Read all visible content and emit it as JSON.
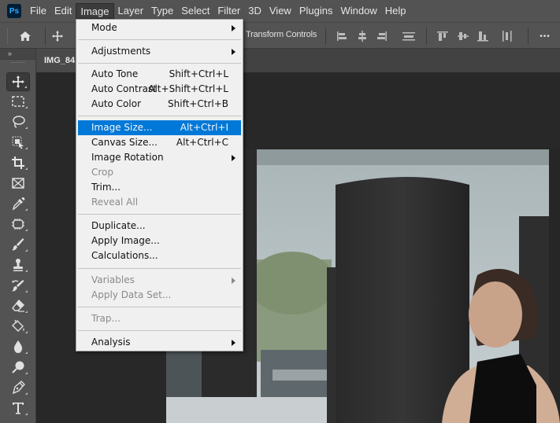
{
  "app": {
    "logo_text": "Ps",
    "name": "Adobe Photoshop"
  },
  "menubar": {
    "items": [
      {
        "label": "File"
      },
      {
        "label": "Edit"
      },
      {
        "label": "Image",
        "active": true
      },
      {
        "label": "Layer"
      },
      {
        "label": "Type"
      },
      {
        "label": "Select"
      },
      {
        "label": "Filter"
      },
      {
        "label": "3D"
      },
      {
        "label": "View"
      },
      {
        "label": "Plugins"
      },
      {
        "label": "Window"
      },
      {
        "label": "Help"
      }
    ]
  },
  "options_bar": {
    "home_icon": "home-icon",
    "move_icon": "move-icon",
    "transform_label": "Transform Controls",
    "align_icons": [
      "align-left-edges",
      "align-horizontal-centers",
      "align-right-edges",
      "distribute-vertical",
      "align-top-edges",
      "align-vertical-centers",
      "align-bottom-edges",
      "distribute-horizontal"
    ],
    "more_label": "•••"
  },
  "toolbar": {
    "collapse_label": "»",
    "tools": [
      {
        "name": "move-tool",
        "icon": "move-icon",
        "active": true
      },
      {
        "name": "rectangular-marquee-tool",
        "icon": "marquee-icon"
      },
      {
        "name": "lasso-tool",
        "icon": "lasso-icon"
      },
      {
        "name": "object-selection-tool",
        "icon": "object-selection-icon"
      },
      {
        "name": "crop-tool",
        "icon": "crop-icon"
      },
      {
        "name": "frame-tool",
        "icon": "frame-icon"
      },
      {
        "name": "eyedropper-tool",
        "icon": "eyedropper-icon"
      },
      {
        "name": "spot-healing-tool",
        "icon": "healing-icon"
      },
      {
        "name": "brush-tool",
        "icon": "brush-icon"
      },
      {
        "name": "clone-stamp-tool",
        "icon": "stamp-icon"
      },
      {
        "name": "history-brush-tool",
        "icon": "history-brush-icon"
      },
      {
        "name": "eraser-tool",
        "icon": "eraser-icon"
      },
      {
        "name": "paint-bucket-tool",
        "icon": "paint-bucket-icon"
      },
      {
        "name": "blur-tool",
        "icon": "blur-drop-icon"
      },
      {
        "name": "dodge-tool",
        "icon": "dodge-icon"
      },
      {
        "name": "pen-tool",
        "icon": "pen-icon"
      },
      {
        "name": "type-tool",
        "icon": "type-icon"
      }
    ]
  },
  "document": {
    "tab_label": "IMG_84"
  },
  "image_menu": {
    "groups": [
      [
        {
          "label": "Mode",
          "submenu": true
        }
      ],
      [
        {
          "label": "Adjustments",
          "submenu": true
        }
      ],
      [
        {
          "label": "Auto Tone",
          "shortcut": "Shift+Ctrl+L"
        },
        {
          "label": "Auto Contrast",
          "shortcut": "Alt+Shift+Ctrl+L"
        },
        {
          "label": "Auto Color",
          "shortcut": "Shift+Ctrl+B"
        }
      ],
      [
        {
          "label": "Image Size...",
          "shortcut": "Alt+Ctrl+I",
          "highlighted": true
        },
        {
          "label": "Canvas Size...",
          "shortcut": "Alt+Ctrl+C"
        },
        {
          "label": "Image Rotation",
          "submenu": true
        },
        {
          "label": "Crop",
          "disabled": true
        },
        {
          "label": "Trim..."
        },
        {
          "label": "Reveal All",
          "disabled": true
        }
      ],
      [
        {
          "label": "Duplicate..."
        },
        {
          "label": "Apply Image..."
        },
        {
          "label": "Calculations..."
        }
      ],
      [
        {
          "label": "Variables",
          "submenu": true,
          "disabled": true
        },
        {
          "label": "Apply Data Set...",
          "disabled": true
        }
      ],
      [
        {
          "label": "Trap...",
          "disabled": true
        }
      ],
      [
        {
          "label": "Analysis",
          "submenu": true
        }
      ]
    ]
  },
  "colors": {
    "highlight": "#0078d7",
    "menubar_bg": "#535353",
    "canvas_bg": "#282828",
    "menu_bg": "#f0f0f0",
    "ps_logo_bg": "#001e36",
    "ps_logo_fg": "#31a8ff"
  }
}
